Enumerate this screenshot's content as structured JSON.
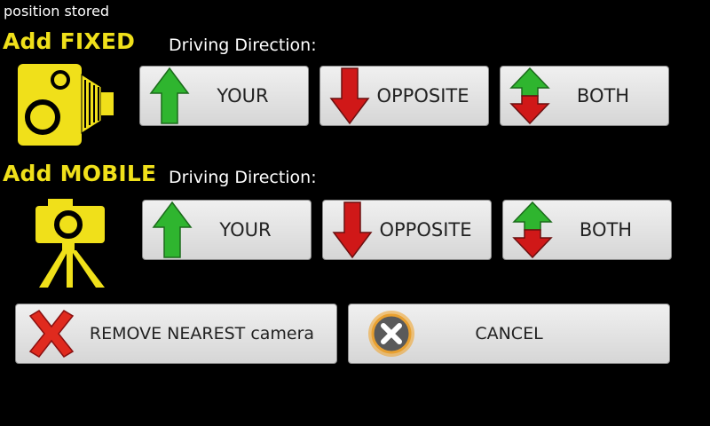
{
  "status_text": "position stored",
  "fixed": {
    "title": "Add FIXED",
    "direction_label": "Driving Direction:",
    "buttons": {
      "your": "YOUR",
      "opposite": "OPPOSITE",
      "both": "BOTH"
    }
  },
  "mobile": {
    "title": "Add MOBILE",
    "direction_label": "Driving Direction:",
    "buttons": {
      "your": "YOUR",
      "opposite": "OPPOSITE",
      "both": "BOTH"
    }
  },
  "actions": {
    "remove_label": "REMOVE NEAREST camera",
    "cancel_label": "CANCEL"
  },
  "colors": {
    "title_yellow": "#f0e01a",
    "arrow_green": "#2fb52f",
    "arrow_red": "#d01818",
    "button_bg": "#e4e4e4"
  },
  "icons": {
    "fixed_camera": "fixed-speed-camera-icon",
    "mobile_camera": "mobile-camera-tripod-icon",
    "up": "arrow-up-icon",
    "down": "arrow-down-icon",
    "both": "arrow-both-icon",
    "remove": "red-x-icon",
    "cancel": "cancel-x-icon"
  }
}
